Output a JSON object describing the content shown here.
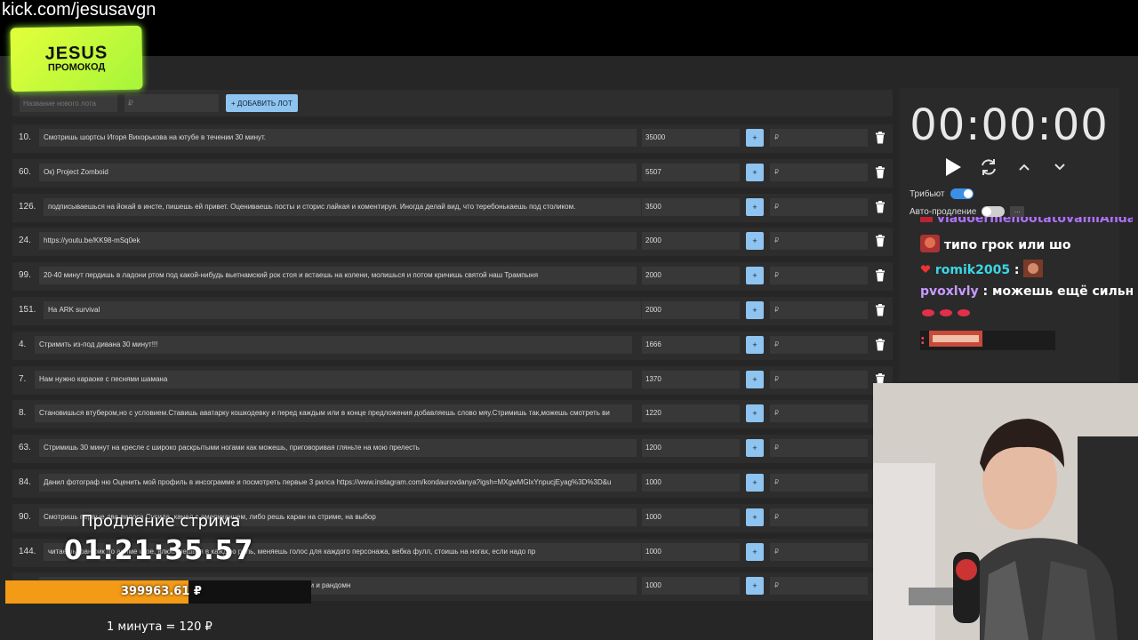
{
  "stream_url": "kick.com/jesusavgn",
  "logo": {
    "line1": "JESUS",
    "line2": "ПРОМОКОД"
  },
  "add_lot": {
    "name_placeholder": "Название нового лота",
    "price_placeholder": "₽",
    "add_label": "+ ДОБАВИТЬ ЛОТ"
  },
  "lots": [
    {
      "id": "10.",
      "text": "Смотришь шортсы Игоря Вихорькова на ютубе в течении 30 минут.",
      "amount": "35000",
      "plus": "+",
      "rub": "₽"
    },
    {
      "id": "60.",
      "text": "Ок) Project Zomboid",
      "amount": "5507",
      "plus": "+",
      "rub": "₽"
    },
    {
      "id": "126.",
      "text": "подписываешься на йокай в инсте, пишешь ей привет. Оцениваешь посты и сторис лайкая и коментируя. Иногда делай вид, что теребонькаешь под столиком.",
      "amount": "3500",
      "plus": "+",
      "rub": "₽"
    },
    {
      "id": "24.",
      "text": "https://youtu.be/KK98-mSq0ek",
      "amount": "2000",
      "plus": "+",
      "rub": "₽"
    },
    {
      "id": "99.",
      "text": "20-40 минут пердишь в ладони ртом под какой-нибудь вьетнамский рок стоя и встаешь на колени, молишься и потом кричишь святой наш Трампыня",
      "amount": "2000",
      "plus": "+",
      "rub": "₽"
    },
    {
      "id": "151.",
      "text": "На ARK survival",
      "amount": "2000",
      "plus": "+",
      "rub": "₽"
    },
    {
      "id": "4.",
      "text": "Стримить из-под дивана 30 минут!!!",
      "amount": "1666",
      "plus": "+",
      "rub": "₽"
    },
    {
      "id": "7.",
      "text": "Нам нужно караоке с песнями шамана",
      "amount": "1370",
      "plus": "+",
      "rub": "₽"
    },
    {
      "id": "8.",
      "text": "Становишься втубером,но с условием.Ставишь аватарку кошкодевку и перед каждым или в конце предложения добавляешь слово мяу.Стримишь так,можешь смотреть ви",
      "amount": "1220",
      "plus": "+",
      "rub": "₽"
    },
    {
      "id": "63.",
      "text": "Стримишь 30 минут на кресле с широко раскрытыми ногами как можешь, приговоривая гляньте на мою прелесть",
      "amount": "1200",
      "plus": "+",
      "rub": "₽"
    },
    {
      "id": "84.",
      "text": "Данил фотограф ню Оценить мой профиль в инсограмме и посмотреть первые 3 рилса https://www.instagram.com/kondaurovdanya?igsh=MXgwMGlxYnpucjEyag%3D%3D&u",
      "amount": "1000",
      "plus": "+",
      "rub": "₽"
    },
    {
      "id": "90.",
      "text": "Смотришь первые два видоса Сусида, канал с американцем, либо решь каран на стриме, на выбор",
      "amount": "1000",
      "plus": "+",
      "rub": "₽"
    },
    {
      "id": "144.",
      "text": "читаешь фанфик по аниме игре, влюбляешься в каждую роль, меняешь голос для каждого персонажа, вебка фулл, стоишь на ногах, если надо пр",
      "amount": "1000",
      "plus": "+",
      "rub": "₽"
    },
    {
      "id": "",
      "text": "стер , обсуждаешь его с чатом и с чат гпт, нахваливать идею этого аниме и манги и рандомн",
      "amount": "1000",
      "plus": "+",
      "rub": "₽"
    }
  ],
  "timer": {
    "display": "00:00:00",
    "tribute_label": "Трибьют",
    "tribute_on": true,
    "auto_extend_label": "Авто-продление",
    "auto_extend_on": false,
    "more_label": "..."
  },
  "chat": {
    "messages": [
      {
        "nick": "vladoermenootatovamiAndaA",
        "sep": " :",
        "text": "",
        "nick_color": "#b070ff"
      },
      {
        "nick": "",
        "sep": "",
        "text": "типо грок или шо",
        "nick_color": "#ffffff"
      },
      {
        "nick": "romik2005",
        "sep": " :",
        "text": "",
        "nick_color": "#3ad7e6"
      },
      {
        "nick": "pvoxlvly",
        "sep": " :",
        "text": " можешь ещё сильнее",
        "nick_color": "#c79bff"
      },
      {
        "nick": "",
        "sep": "",
        "text": "",
        "nick_color": "#ffffff"
      },
      {
        "nick": "",
        "sep": ":",
        "text": "",
        "nick_color": "#ff3d5a"
      }
    ]
  },
  "extension": {
    "title": "Продление стрима",
    "time": "01:21:35.57",
    "amount": "399963.61 ₽",
    "progress_fraction": 0.6,
    "rate": "1 минута = 120 ₽"
  },
  "colors": {
    "accent_blue": "#8ec4ef",
    "progress_orange": "#f39a16",
    "logo_green": "#c6ff3a"
  }
}
